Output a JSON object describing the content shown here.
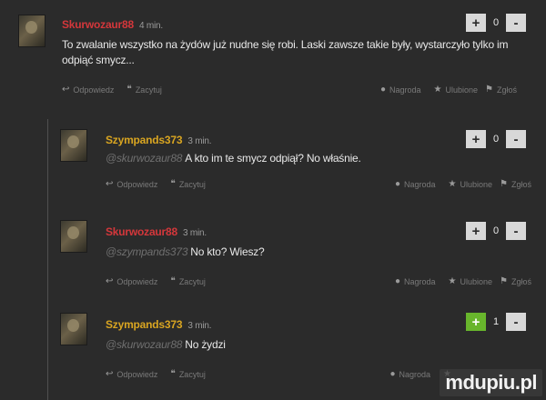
{
  "actions": {
    "reply": "Odpowiedz",
    "flag": "Zacytuj",
    "reward": "Nagroda",
    "favorite": "Ulubione",
    "report": "Zgłoś"
  },
  "comments": [
    {
      "author": "Skurwozaur88",
      "time": "4 min.",
      "mention": "",
      "text": "To zwalanie wszystko na żydów już nudne się robi. Laski zawsze takie były, wystarczyło tylko im odpiąć smycz...",
      "score": "0",
      "upvoted": false
    },
    {
      "author": "Szympands373",
      "time": "3 min.",
      "mention": "@skurwozaur88",
      "text": "A kto im te smycz odpiął? No właśnie.",
      "score": "0",
      "upvoted": false
    },
    {
      "author": "Skurwozaur88",
      "time": "3 min.",
      "mention": "@szympands373",
      "text": "No kto? Wiesz?",
      "score": "0",
      "upvoted": false
    },
    {
      "author": "Szympands373",
      "time": "3 min.",
      "mention": "@skurwozaur88",
      "text": "No żydzi",
      "score": "1",
      "upvoted": true
    }
  ],
  "vote": {
    "plus": "+",
    "minus": "-"
  },
  "icons": {
    "reply": "reply-arrow-icon",
    "flag": "quote-icon",
    "reward": "reward-icon",
    "favorite": "star-icon",
    "report": "flag-icon"
  },
  "colors": {
    "author_red": "#d4373b",
    "author_gold": "#d9a521",
    "upvote_active": "#68b52c"
  },
  "watermark": "mdupiu.pl"
}
